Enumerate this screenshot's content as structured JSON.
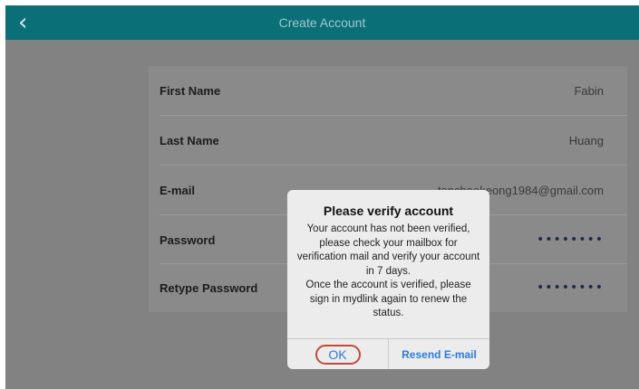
{
  "navbar": {
    "title": "Create Account",
    "back_icon": "chevron-left-icon"
  },
  "form": {
    "rows": [
      {
        "label": "First Name",
        "value": "Fabin"
      },
      {
        "label": "Last Name",
        "value": "Huang"
      },
      {
        "label": "E-mail",
        "value": "tancheekeong1984@gmail.com"
      },
      {
        "label": "Password",
        "value": "••••••••"
      },
      {
        "label": "Retype Password",
        "value": "••••••••"
      }
    ]
  },
  "alert": {
    "title": "Please verify account",
    "message": "Your account has not been verified, please check your mailbox for verification mail and verify your account in 7 days.\nOnce the account is verified, please sign in mydlink again to renew the status.",
    "ok_label": "OK",
    "resend_label": "Resend E-mail"
  }
}
